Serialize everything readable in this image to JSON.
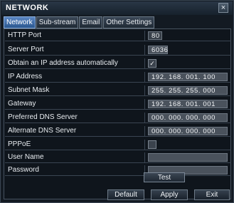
{
  "window": {
    "title": "NETWORK",
    "close_label": "×"
  },
  "tabs": [
    {
      "label": "Network",
      "active": true
    },
    {
      "label": "Sub-stream",
      "active": false
    },
    {
      "label": "Email",
      "active": false
    },
    {
      "label": "Other Settings",
      "active": false
    }
  ],
  "form": {
    "http_port": {
      "label": "HTTP Port",
      "value": "80"
    },
    "server_port": {
      "label": "Server Port",
      "value": "6036"
    },
    "obtain_ip_auto": {
      "label": "Obtain an IP address automatically",
      "checked": true,
      "mark": "✓"
    },
    "ip_address": {
      "label": "IP Address",
      "value": "192. 168. 001. 100"
    },
    "subnet_mask": {
      "label": "Subnet Mask",
      "value": "255. 255. 255. 000"
    },
    "gateway": {
      "label": "Gateway",
      "value": "192. 168. 001. 001"
    },
    "preferred_dns": {
      "label": "Preferred DNS Server",
      "value": "000. 000. 000. 000"
    },
    "alternate_dns": {
      "label": "Alternate DNS Server",
      "value": "000. 000. 000. 000"
    },
    "pppoe": {
      "label": "PPPoE",
      "checked": false
    },
    "user_name": {
      "label": "User Name",
      "value": ""
    },
    "password": {
      "label": "Password",
      "value": ""
    },
    "test_button": "Test"
  },
  "footer": {
    "default_label": "Default",
    "apply_label": "Apply",
    "exit_label": "Exit"
  }
}
